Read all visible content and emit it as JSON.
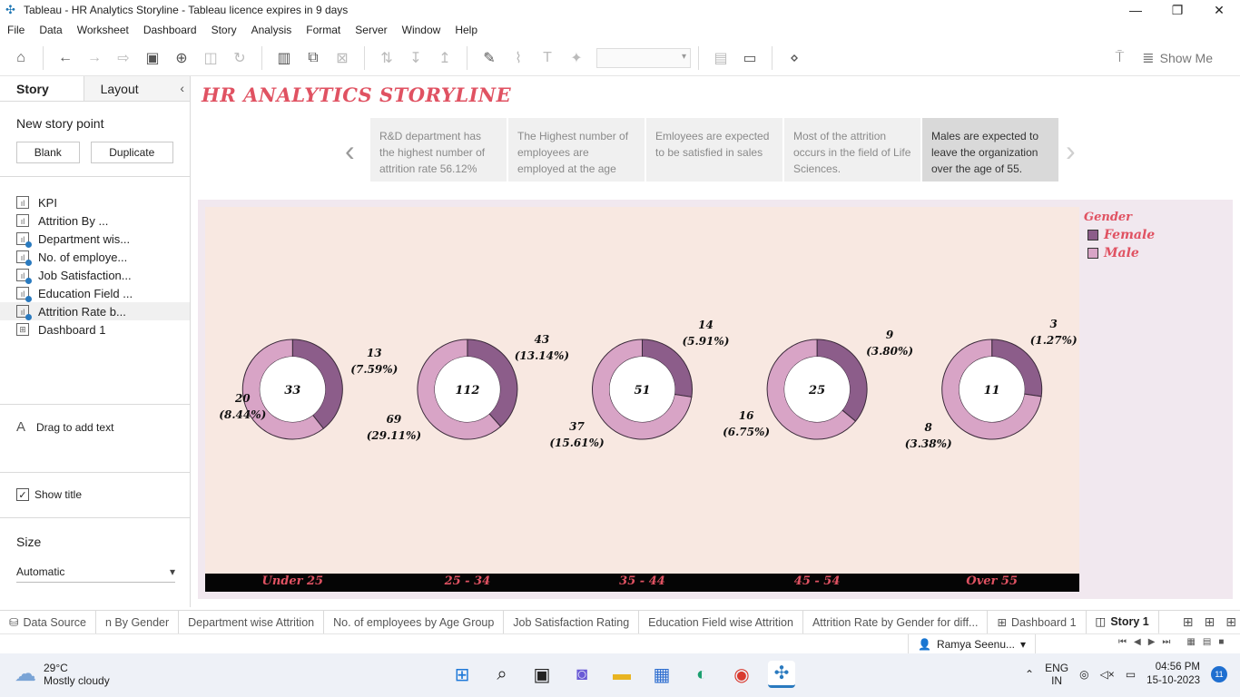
{
  "window": {
    "title": "Tableau - HR Analytics Storyline - Tableau licence expires in 9 days",
    "minimize_glyph": "—",
    "restore_glyph": "❐",
    "close_glyph": "✕"
  },
  "menu": [
    "File",
    "Data",
    "Worksheet",
    "Dashboard",
    "Story",
    "Analysis",
    "Format",
    "Server",
    "Window",
    "Help"
  ],
  "toolbar": {
    "show_me_label": "Show Me",
    "icons": [
      "home-icon",
      "undo-icon",
      "redo-icon",
      "swap-icon",
      "save-icon",
      "add-datasource-icon",
      "pause-icon",
      "refresh-icon",
      "new-sheet-icon",
      "duplicate-icon",
      "clear-icon",
      "swap-rows-icon",
      "sort-asc-icon",
      "sort-desc-icon",
      "highlight-icon",
      "attach-icon",
      "text-icon",
      "pin-icon",
      "fit-icon",
      "presentation-icon",
      "share-icon"
    ]
  },
  "left_pane": {
    "tab_story": "Story",
    "tab_layout": "Layout",
    "new_story_point": "New story point",
    "blank_button": "Blank",
    "duplicate_button": "Duplicate",
    "sheets": [
      {
        "label": "KPI",
        "badge": false
      },
      {
        "label": "Attrition By ...",
        "badge": false
      },
      {
        "label": "Department wis...",
        "badge": true
      },
      {
        "label": "No. of employe...",
        "badge": true
      },
      {
        "label": "Job Satisfaction...",
        "badge": true
      },
      {
        "label": "Education Field ...",
        "badge": true
      },
      {
        "label": "Attrition Rate b...",
        "badge": true
      },
      {
        "label": "Dashboard 1",
        "badge": false
      }
    ],
    "drag_text": "Drag to add text",
    "show_title_label": "Show title",
    "show_title_checked": true,
    "size_label": "Size",
    "size_value": "Automatic"
  },
  "story": {
    "title": "HR ANALYTICS STORYLINE",
    "captions": [
      {
        "text": "R&D department has the highest  number of attrition rate 56.12%",
        "selected": false
      },
      {
        "text": "The Highest number of employees are employed at the age",
        "selected": false
      },
      {
        "text": "Emloyees are expected to be satisfied in sales",
        "selected": false
      },
      {
        "text": "Most of the attrition occurs in the field of Life Sciences.",
        "selected": false
      },
      {
        "text": "Males are expected to leave the organization over the age of 55.",
        "selected": true
      }
    ]
  },
  "chart_data": {
    "type": "donut",
    "legend_title": "Gender",
    "legend_position": "right",
    "series": [
      {
        "name": "Female",
        "color": "#8c5d8a"
      },
      {
        "name": "Male",
        "color": "#d8a4c6"
      }
    ],
    "categories": [
      "Under 25",
      "25 - 34",
      "35 - 44",
      "45 - 54",
      "Over 55"
    ],
    "totals": [
      33,
      112,
      51,
      25,
      11
    ],
    "female": [
      13,
      43,
      14,
      9,
      3
    ],
    "female_labels": [
      "(7.59%)",
      "(13.14%)",
      "(5.91%)",
      "(3.80%)",
      "(1.27%)"
    ],
    "male": [
      20,
      69,
      37,
      16,
      8
    ],
    "male_labels": [
      "(8.44%)",
      "(29.11%)",
      "(15.61%)",
      "(6.75%)",
      "(3.38%)"
    ]
  },
  "bottom_tabs": [
    "Data Source",
    "n By Gender",
    "Department wise Attrition",
    "No. of employees by Age Group",
    "Job Satisfaction Rating",
    "Education Field wise Attrition",
    "Attrition Rate by Gender for diff...",
    "Dashboard 1",
    "Story 1"
  ],
  "active_tab": "Story 1",
  "status": {
    "user": "Ramya Seenu..."
  },
  "taskbar": {
    "temp": "29°C",
    "weather": "Mostly cloudy",
    "lang1": "ENG",
    "lang2": "IN",
    "time": "04:56 PM",
    "date": "15-10-2023",
    "notifications": "11"
  }
}
